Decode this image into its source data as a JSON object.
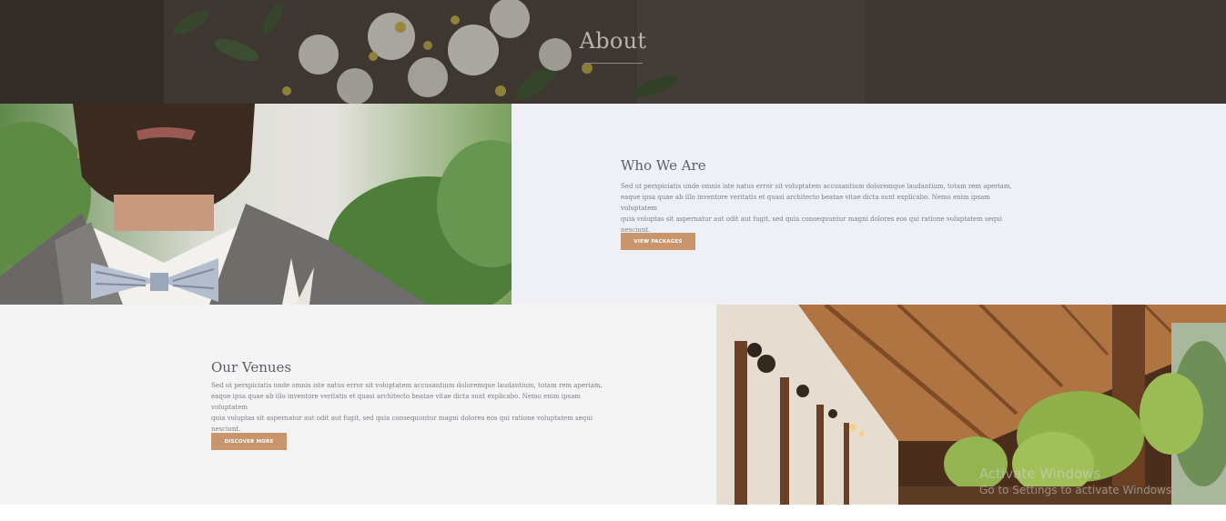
{
  "hero": {
    "title": "About"
  },
  "who_we_are": {
    "title": "Who We Are",
    "lines": [
      "Sed ut perspiciatis unde omnis iste natus error sit voluptatem accusantium doloremque laudantium, totam rem aperiam,",
      "eaque ipsa quae ab illo inventore veritatis et quasi architecto beatae vitae dicta sunt explicabo. Nemo enim ipsam voluptatem",
      "quia voluptas sit aspernatur aut odit aut fugit, sed quia consequuntur magni dolores eos qui ratione voluptatem sequi",
      "nesciunt."
    ],
    "button_label": "VIEW PACKAGES"
  },
  "our_venues": {
    "title": "Our Venues",
    "lines": [
      "Sed ut perspiciatis unde omnis iste natus error sit voluptatem accusantium doloremque laudantium, totam rem aperiam,",
      "eaque ipsa quae ab illo inventore veritatis et quasi architecto beatae vitae dicta sunt explicabo. Nemo enim ipsam voluptatem",
      "quia voluptas sit aspernatur aut odit aut fugit, sed quia consequuntur magni dolores eos qui ratione voluptatem sequi",
      "nesciunt."
    ],
    "button_label": "DISCOVER MORE"
  },
  "watermark": {
    "line1": "Activate Windows",
    "line2": "Go to Settings to activate Windows."
  },
  "colors": {
    "accent": "#c9956c",
    "panel_light": "#eff0f5",
    "panel_grey": "#f4f4f5",
    "heading": "#5c5f6a"
  }
}
